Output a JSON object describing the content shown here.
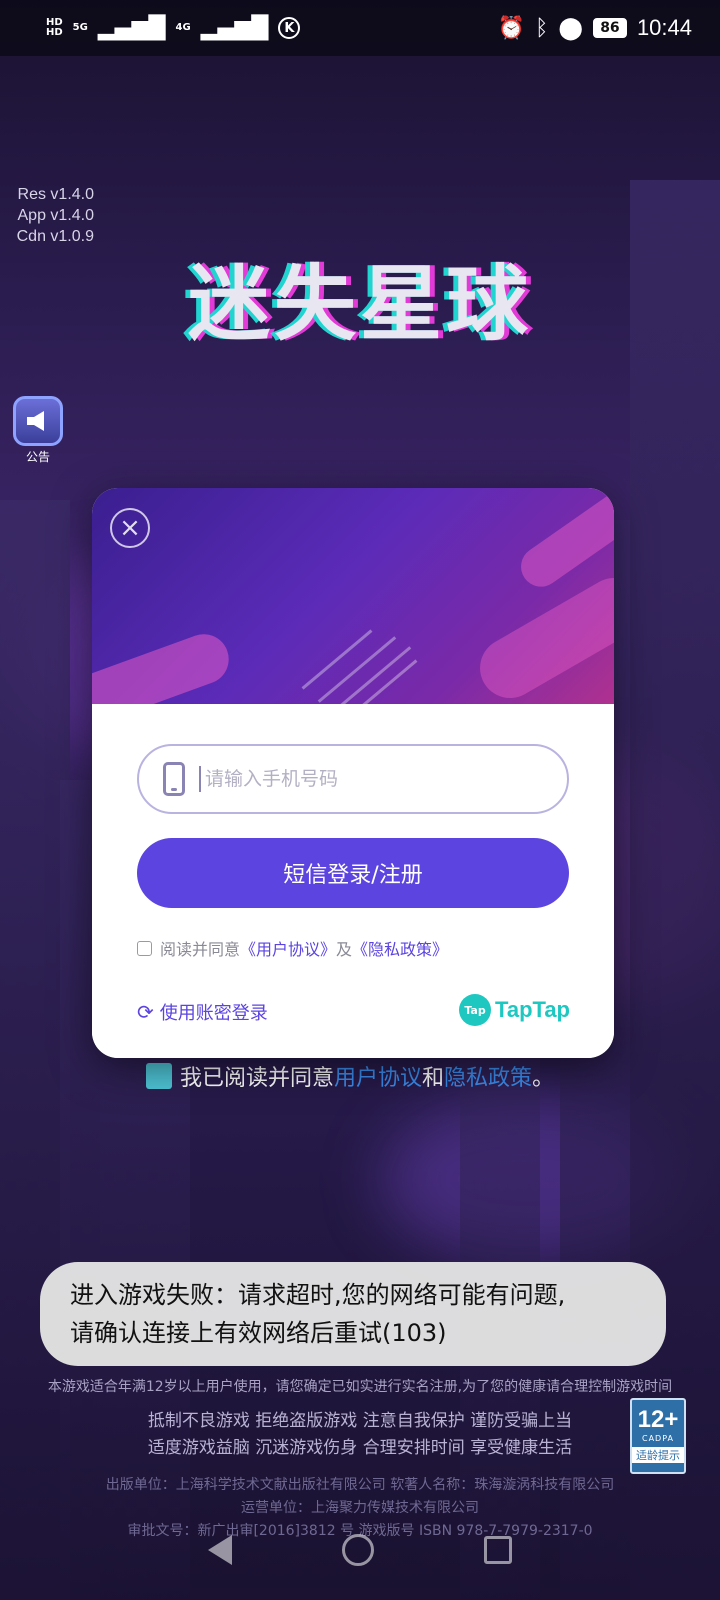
{
  "status_bar": {
    "time": "10:44",
    "battery": "86",
    "network_1": "5G",
    "network_2": "4G",
    "hd_1": "HD",
    "hd_2": "HD",
    "icons": [
      "alarm-icon",
      "bluetooth-icon",
      "location-icon",
      "battery-icon",
      "signal-icon",
      "k-icon"
    ]
  },
  "version": {
    "res": "Res v1.4.0",
    "app": "App v1.4.0",
    "cdn": "Cdn v1.0.9"
  },
  "game": {
    "title": "迷失星球",
    "notice_label": "公告"
  },
  "dialog": {
    "phone_placeholder": "请输入手机号码",
    "phone_value": "",
    "login_button": "短信登录/注册",
    "agree_prefix": "阅读并同意",
    "user_agreement": "《用户协议》",
    "agree_and": "及",
    "privacy_policy": "《隐私政策》",
    "alt_login": "使用账密登录",
    "taptap_badge": "Tap",
    "taptap_text": "TapTap"
  },
  "background_agreement": {
    "prefix": "我已阅读并同意",
    "user_agreement": "用户协议",
    "and": "和",
    "privacy_policy": "隐私政策",
    "suffix": "。"
  },
  "toast": {
    "line1": "进入游戏失败：请求超时,您的网络可能有问题,",
    "line2": "请确认连接上有效网络后重试(103)"
  },
  "footer": {
    "age_notice": "本游戏适合年满12岁以上用户使用，请您确定已如实进行实名注册,为了您的健康请合理控制游戏时间",
    "slogan_line1": "抵制不良游戏  拒绝盗版游戏  注意自我保护  谨防受骗上当",
    "slogan_line2": "适度游戏益脑  沉迷游戏伤身  合理安排时间  享受健康生活",
    "publisher_line1": "出版单位：上海科学技术文献出版社有限公司  软著人名称：珠海漩涡科技有限公司",
    "publisher_line2": "运营单位：上海聚力传媒技术有限公司",
    "publisher_line3": "审批文号：新广出审[2016]3812 号         游戏版号 ISBN 978-7-7979-2317-0"
  },
  "cadpa": {
    "age": "12+",
    "org": "CADPA",
    "tip": "适龄提示"
  },
  "colors": {
    "accent": "#5b44e0",
    "taptap": "#1ec8c0",
    "toast_bg": "#e4e4e4"
  }
}
